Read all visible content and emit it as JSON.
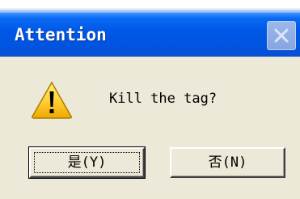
{
  "dialog": {
    "title": "Attention",
    "message": "Kill the tag?",
    "icon": "warning-icon",
    "close_icon": "close-icon",
    "buttons": {
      "yes_label": "是(Y)",
      "no_label": "否(N)"
    }
  }
}
